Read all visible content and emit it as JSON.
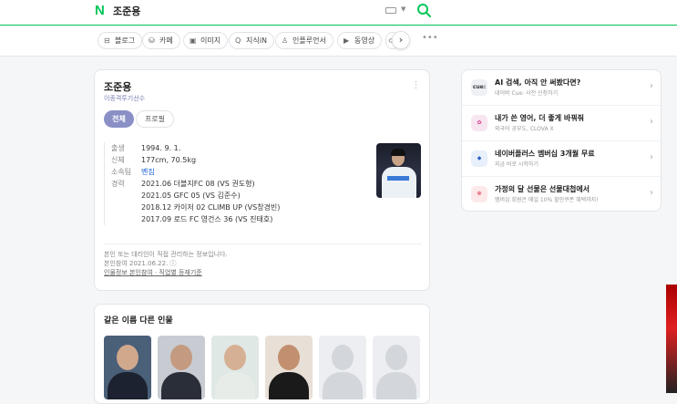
{
  "header": {
    "logo": "N",
    "query": "조준용"
  },
  "tabs": [
    {
      "icon": "blog-icon",
      "glyph": "⊟",
      "label": "블로그"
    },
    {
      "icon": "cafe-icon",
      "glyph": "☕",
      "label": "카페"
    },
    {
      "icon": "image-icon",
      "glyph": "▣",
      "label": "이미지"
    },
    {
      "icon": "knowledge-icon",
      "glyph": "Q",
      "label": "지식iN"
    },
    {
      "icon": "influencer-icon",
      "glyph": "♙",
      "label": "인플루언서"
    },
    {
      "icon": "video-icon",
      "glyph": "▶",
      "label": "동영상"
    },
    {
      "icon": "more-tab-icon",
      "glyph": "⊂",
      "label": ""
    }
  ],
  "profile": {
    "name": "조준용",
    "job": "이종격투기선수",
    "tab_all": "전체",
    "tab_profile": "프로필",
    "birth_label": "출생",
    "birth": "1994. 9. 1.",
    "body_label": "신체",
    "body": "177cm, 70.5kg",
    "team_label": "소속팀",
    "team": "벤짐",
    "career_label": "경력",
    "career": [
      "2021.06 더블지FC 08 (VS 권도형)",
      "2021.05 GFC 05 (VS 김준수)",
      "2018.12 카이저 02 CLIMB UP (VS창경빈)",
      "2017.09 로드 FC 영건스 36 (VS 진태호)"
    ],
    "note": "본인 또는 대리인이 직접 관리하는 정보입니다.",
    "verified": "본인참여 2021.06.22. ⓘ",
    "links": "인물정보 본인참여 · 직업별 등재기준"
  },
  "same_name": {
    "title": "같은 이름 다른 인물"
  },
  "side": [
    {
      "icon": "cue-icon",
      "icon_text": "cue:",
      "title": "AI 검색, 아직 안 써봤다면?",
      "sub": "네이버 Cue: 사전 신청하기"
    },
    {
      "icon": "clova-icon",
      "icon_text": "",
      "title": "내가 쓴 영어, 더 좋게 바꿔줘",
      "sub": "외국어 공부도, CLOVA X"
    },
    {
      "icon": "plus-icon",
      "icon_text": "",
      "title": "네이버플러스 멤버십 3개월 무료",
      "sub": "지금 바로 시작하기"
    },
    {
      "icon": "gift-icon",
      "icon_text": "",
      "title": "가정의 달 선물은 선물대첩에서",
      "sub": "멤버십 회원은 매일 10% 할인쿠폰 혜택까지!"
    }
  ],
  "colors": {
    "brand": "#03c75a",
    "accent": "#8a8fc6",
    "link": "#1a5fd7"
  }
}
